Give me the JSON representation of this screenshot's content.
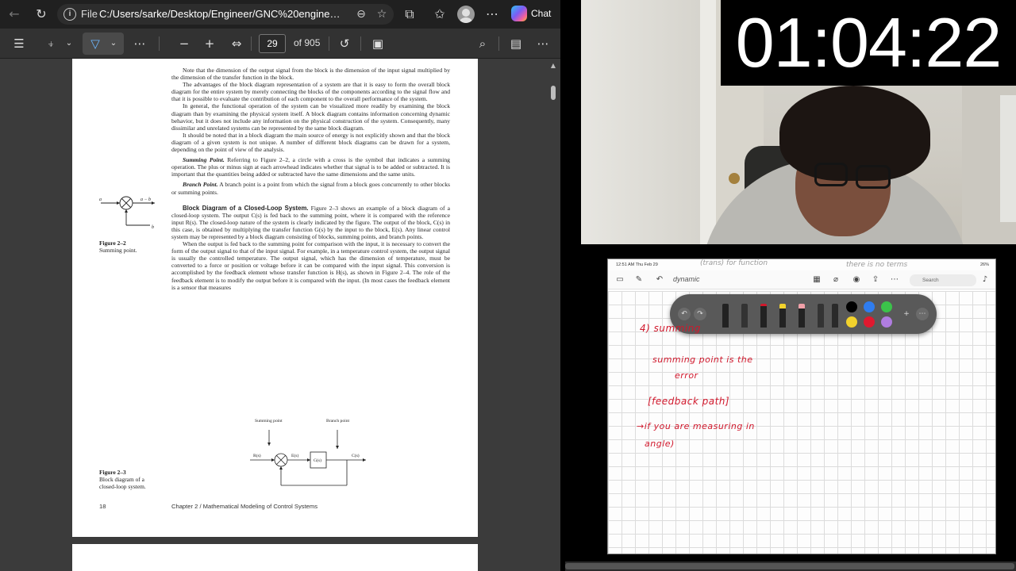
{
  "browser": {
    "address_bar": {
      "file_label": "File",
      "url": "C:/Users/sarke/Desktop/Engineer/GNC%20engineeri...",
      "chat_label": "Chat"
    },
    "pdf_toolbar": {
      "page_number": "29",
      "page_total": "of 905"
    },
    "pdf": {
      "para1": "Note that the dimension of the output signal from the block is the dimension of the input signal multiplied by the dimension of the transfer function in the block.",
      "para2": "The advantages of the block diagram representation of a system are that it is easy to form the overall block diagram for the entire system by merely connecting the blocks of the components according to the signal flow and that it is possible to evaluate the contribution of each component to the overall performance of the system.",
      "para3": "In general, the functional operation of the system can be visualized more readily by examining the block diagram than by examining the physical system itself. A block diagram contains information concerning dynamic behavior, but it does not include any information on the physical construction of the system. Consequently, many dissimilar and unrelated systems can be represented by the same block diagram.",
      "para4": "It should be noted that in a block diagram the main source of energy is not explicitly shown and that the block diagram of a given system is not unique. A number of different block diagrams can be drawn for a system, depending on the point of view of the analysis.",
      "summing_head": "Summing Point.",
      "summing_text": "Referring to Figure 2–2, a circle with a cross is the symbol that indicates a summing operation. The plus or minus sign at each arrowhead indicates whether that signal is to be added or subtracted. It is important that the quantities being added or subtracted have the same dimensions and the same units.",
      "branch_head": "Branch Point.",
      "branch_text": "A branch point is a point from which the signal from a block goes concurrently to other blocks or summing points.",
      "closed_head": "Block Diagram of a Closed-Loop System.",
      "closed_text": "Figure 2–3 shows an example of a block diagram of a closed-loop system. The output C(s) is fed back to the summing point, where it is compared with the reference input R(s). The closed-loop nature of the system is clearly indicated by the figure. The output of the block, C(s) in this case, is obtained by multiplying the transfer function G(s) by the input to the block, E(s). Any linear control system may be represented by a block diagram consisting of blocks, summing points, and branch points.",
      "feedback_text": "When the output is fed back to the summing point for comparison with the input, it is necessary to convert the form of the output signal to that of the input signal. For example, in a temperature control system, the output signal is usually the controlled temperature. The output signal, which has the dimension of temperature, must be converted to a force or position or voltage before it can be compared with the input signal. This conversion is accomplished by the feedback element whose transfer function is H(s), as shown in Figure 2–4. The role of the feedback element is to modify the output before it is compared with the input. (In most cases the feedback element is a sensor that measures",
      "fig22_title": "Figure 2–2",
      "fig22_caption": "Summing point.",
      "fig23_title": "Figure 2–3",
      "fig23_caption": "Block diagram of a closed-loop system.",
      "diag_a": "a",
      "diag_amb": "a − b",
      "diag_b": "b",
      "diag_summing_label": "Summing point",
      "diag_branch_label": "Branch point",
      "diag_R": "R(s)",
      "diag_E": "E(s)",
      "diag_G": "G(s)",
      "diag_C": "C(s)",
      "page_num": "18",
      "chapter": "Chapter 2   /   Mathematical Modeling of Control Systems"
    }
  },
  "timer": {
    "value": "01:04:22"
  },
  "tablet": {
    "status": {
      "time": "12:51 AM  Thu Feb 29",
      "battery": "26%"
    },
    "title": "dynamic",
    "search_placeholder": "Search",
    "faint_top1": "(trans) for  function",
    "faint_top2": "there  is  no  terms",
    "notes": {
      "line1": "4) summing",
      "line2": "summing  point  is  the",
      "line3": "error",
      "line4": "[feedback path]",
      "line5": "→if  you  are  measuring  in",
      "line6": "angle)"
    },
    "pen_colors": [
      "#000000",
      "#2f7df0",
      "#3bc24a",
      "#f2d22c",
      "#e0192f",
      "#b07de0"
    ]
  }
}
